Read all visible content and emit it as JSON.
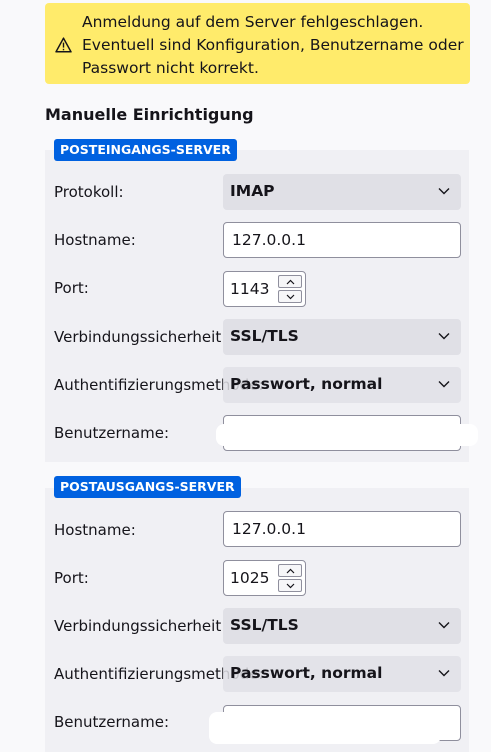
{
  "alert": {
    "icon": "warning-icon",
    "message": "Anmeldung auf dem Server fehlgeschlagen.\nEventuell sind Konfiguration, Benutzername oder\nPasswort nicht korrekt."
  },
  "manual_setup": {
    "title": "Manuelle Einrichtigung"
  },
  "incoming": {
    "badge": "POSTEINGANGS-SERVER",
    "protocol_label": "Protokoll:",
    "protocol_value": "IMAP",
    "hostname_label": "Hostname:",
    "hostname_value": "127.0.0.1",
    "port_label": "Port:",
    "port_value": "1143",
    "security_label": "Verbindungssicherheit:",
    "security_value": "SSL/TLS",
    "auth_label": "Authentifizierungsmethode:",
    "auth_value": "Passwort, normal",
    "username_label": "Benutzername:",
    "username_value": ""
  },
  "outgoing": {
    "badge": "POSTAUSGANGS-SERVER",
    "hostname_label": "Hostname:",
    "hostname_value": "127.0.0.1",
    "port_label": "Port:",
    "port_value": "1025",
    "security_label": "Verbindungssicherheit:",
    "security_value": "SSL/TLS",
    "auth_label": "Authentifizierungsmethode:",
    "auth_value": "Passwort, normal",
    "username_label": "Benutzername:",
    "username_value": ""
  },
  "colors": {
    "alert_bg": "#ffeb6b",
    "badge_bg": "#0061e0",
    "panel_bg": "#f0f0f4"
  }
}
